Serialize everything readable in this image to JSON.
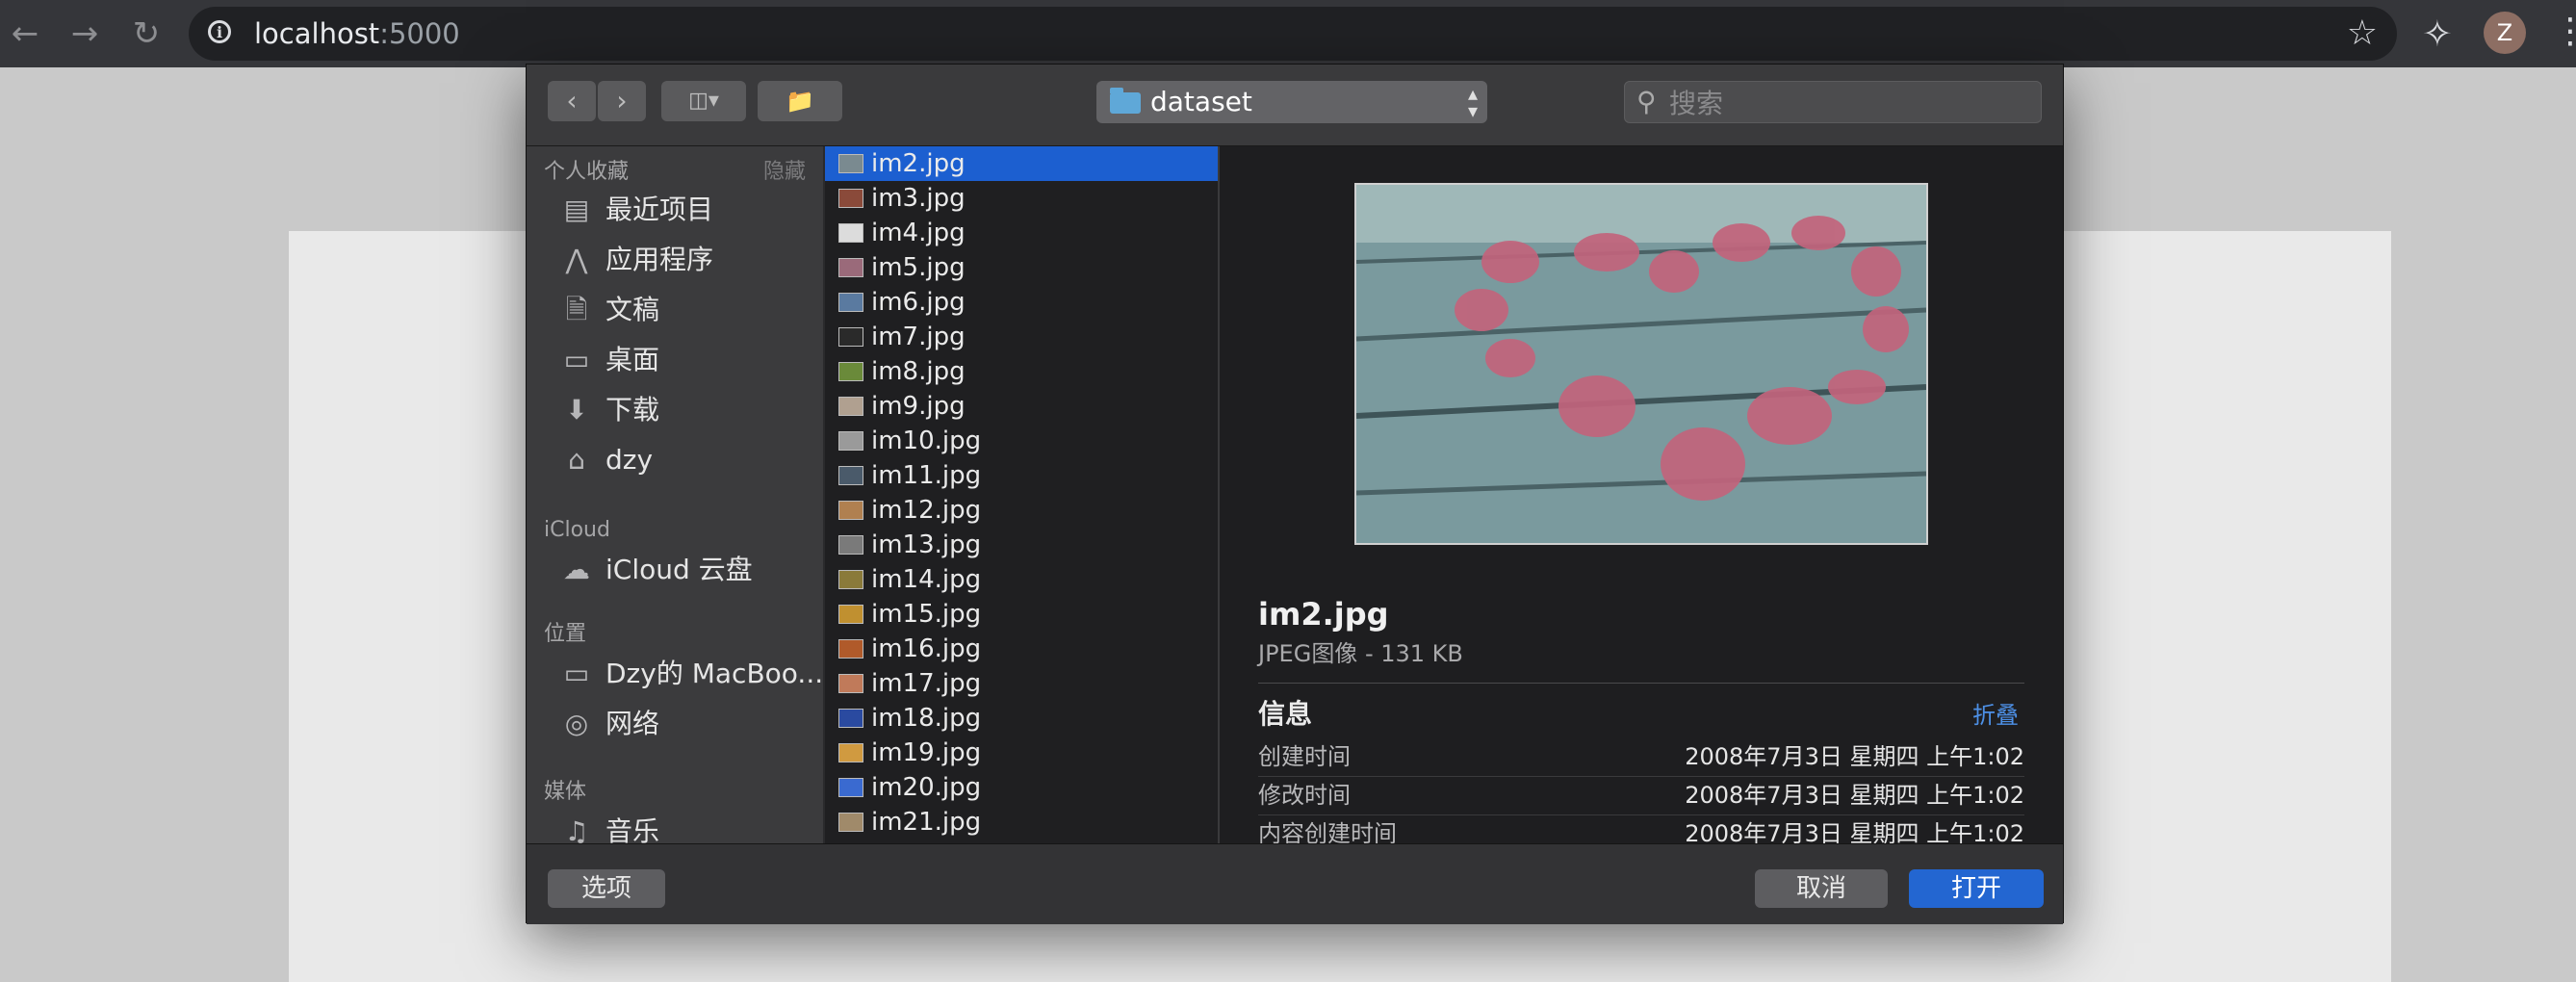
{
  "browser": {
    "url_host": "localhost",
    "url_port": ":5000",
    "profile_initial": "Z"
  },
  "dialog": {
    "location": "dataset",
    "search_placeholder": "搜索",
    "sidebar": {
      "favorites_header": "个人收藏",
      "hide_label": "隐藏",
      "favorites": [
        {
          "label": "最近项目",
          "icon": "recent-icon"
        },
        {
          "label": "应用程序",
          "icon": "applications-icon"
        },
        {
          "label": "文稿",
          "icon": "documents-icon"
        },
        {
          "label": "桌面",
          "icon": "desktop-icon"
        },
        {
          "label": "下载",
          "icon": "downloads-icon"
        },
        {
          "label": "dzy",
          "icon": "home-icon"
        }
      ],
      "icloud_header": "iCloud",
      "icloud": [
        {
          "label": "iCloud 云盘",
          "icon": "cloud-icon"
        }
      ],
      "locations_header": "位置",
      "locations": [
        {
          "label": "Dzy的 MacBoo...",
          "icon": "laptop-icon"
        },
        {
          "label": "网络",
          "icon": "network-icon"
        }
      ],
      "media_header": "媒体",
      "media": [
        {
          "label": "音乐",
          "icon": "music-icon"
        }
      ]
    },
    "files": [
      {
        "name": "im2.jpg",
        "selected": true,
        "color": "#7a8a90"
      },
      {
        "name": "im3.jpg",
        "color": "#8a4a3a"
      },
      {
        "name": "im4.jpg",
        "color": "#dcdcdc"
      },
      {
        "name": "im5.jpg",
        "color": "#9a6a7a"
      },
      {
        "name": "im6.jpg",
        "color": "#5a7aa0"
      },
      {
        "name": "im7.jpg",
        "color": "#2a2a2a"
      },
      {
        "name": "im8.jpg",
        "color": "#6a8a3a"
      },
      {
        "name": "im9.jpg",
        "color": "#b0a090"
      },
      {
        "name": "im10.jpg",
        "color": "#9a9a9a"
      },
      {
        "name": "im11.jpg",
        "color": "#4a5a6a"
      },
      {
        "name": "im12.jpg",
        "color": "#b08050"
      },
      {
        "name": "im13.jpg",
        "color": "#7a7a7a"
      },
      {
        "name": "im14.jpg",
        "color": "#8a7a3a"
      },
      {
        "name": "im15.jpg",
        "color": "#c09030"
      },
      {
        "name": "im16.jpg",
        "color": "#b05a2a"
      },
      {
        "name": "im17.jpg",
        "color": "#c07a5a"
      },
      {
        "name": "im18.jpg",
        "color": "#2a4aa0"
      },
      {
        "name": "im19.jpg",
        "color": "#d09a40"
      },
      {
        "name": "im20.jpg",
        "color": "#3a6ad0"
      },
      {
        "name": "im21.jpg",
        "color": "#a08a6a"
      }
    ],
    "preview": {
      "title": "im2.jpg",
      "subtitle": "JPEG图像 - 131 KB",
      "info_label": "信息",
      "collapse_label": "折叠",
      "meta": [
        {
          "key": "创建时间",
          "value": "2008年7月3日 星期四 上午1:02"
        },
        {
          "key": "修改时间",
          "value": "2008年7月3日 星期四 上午1:02"
        },
        {
          "key": "内容创建时间",
          "value": "2008年7月3日 星期四 上午1:02"
        }
      ]
    },
    "footer": {
      "options_label": "选项",
      "cancel_label": "取消",
      "open_label": "打开"
    }
  }
}
